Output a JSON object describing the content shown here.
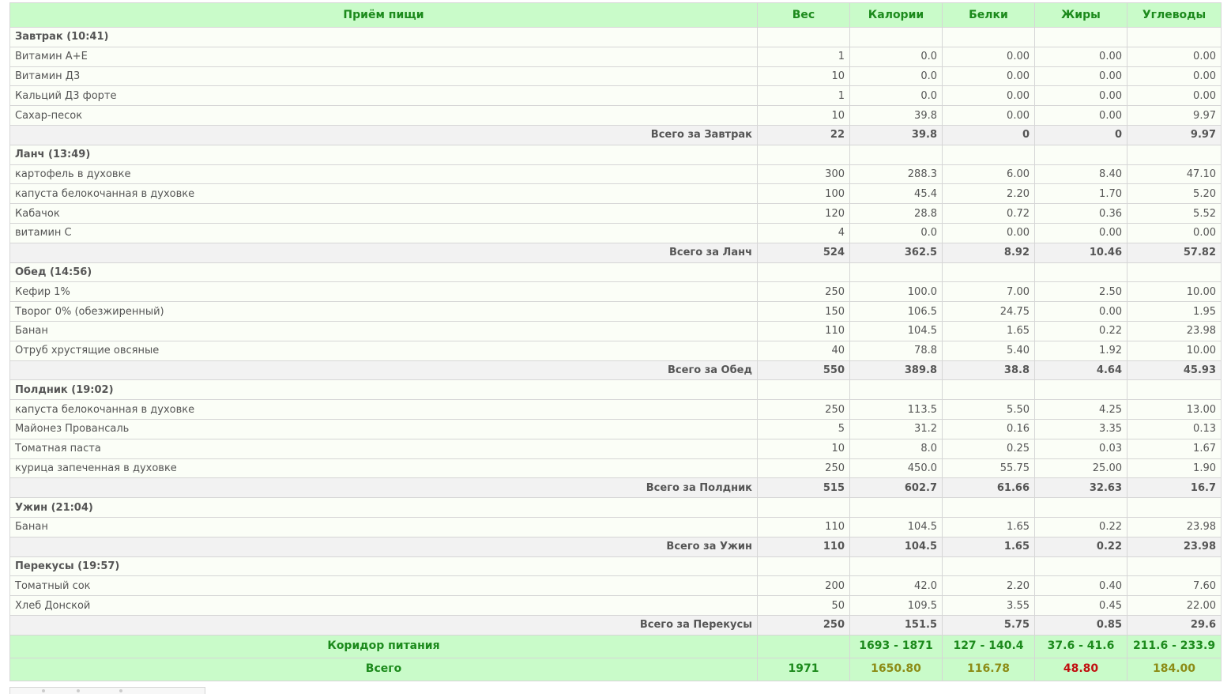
{
  "table": {
    "headers": [
      "Приём пищи",
      "Вес",
      "Калории",
      "Белки",
      "Жиры",
      "Углеводы"
    ],
    "meals": [
      {
        "title": "Завтрак (10:41)",
        "items": [
          [
            "Витамин А+Е",
            "1",
            "0.0",
            "0.00",
            "0.00",
            "0.00"
          ],
          [
            "Витамин Д3",
            "10",
            "0.0",
            "0.00",
            "0.00",
            "0.00"
          ],
          [
            "Кальций Д3 форте",
            "1",
            "0.0",
            "0.00",
            "0.00",
            "0.00"
          ],
          [
            "Сахар-песок",
            "10",
            "39.8",
            "0.00",
            "0.00",
            "9.97"
          ]
        ],
        "total": [
          "Всего за Завтрак",
          "22",
          "39.8",
          "0",
          "0",
          "9.97"
        ]
      },
      {
        "title": "Ланч (13:49)",
        "items": [
          [
            "картофель в духовке",
            "300",
            "288.3",
            "6.00",
            "8.40",
            "47.10"
          ],
          [
            "капуста белокочанная в духовке",
            "100",
            "45.4",
            "2.20",
            "1.70",
            "5.20"
          ],
          [
            "Кабачок",
            "120",
            "28.8",
            "0.72",
            "0.36",
            "5.52"
          ],
          [
            "витамин С",
            "4",
            "0.0",
            "0.00",
            "0.00",
            "0.00"
          ]
        ],
        "total": [
          "Всего за Ланч",
          "524",
          "362.5",
          "8.92",
          "10.46",
          "57.82"
        ]
      },
      {
        "title": "Обед (14:56)",
        "items": [
          [
            "Кефир 1%",
            "250",
            "100.0",
            "7.00",
            "2.50",
            "10.00"
          ],
          [
            "Творог 0% (обезжиренный)",
            "150",
            "106.5",
            "24.75",
            "0.00",
            "1.95"
          ],
          [
            "Банан",
            "110",
            "104.5",
            "1.65",
            "0.22",
            "23.98"
          ],
          [
            "Отруб хрустящие овсяные",
            "40",
            "78.8",
            "5.40",
            "1.92",
            "10.00"
          ]
        ],
        "total": [
          "Всего за Обед",
          "550",
          "389.8",
          "38.8",
          "4.64",
          "45.93"
        ]
      },
      {
        "title": "Полдник (19:02)",
        "items": [
          [
            "капуста белокочанная в духовке",
            "250",
            "113.5",
            "5.50",
            "4.25",
            "13.00"
          ],
          [
            "Майонез Провансаль",
            "5",
            "31.2",
            "0.16",
            "3.35",
            "0.13"
          ],
          [
            "Томатная паста",
            "10",
            "8.0",
            "0.25",
            "0.03",
            "1.67"
          ],
          [
            "курица запеченная в духовке",
            "250",
            "450.0",
            "55.75",
            "25.00",
            "1.90"
          ]
        ],
        "total": [
          "Всего за Полдник",
          "515",
          "602.7",
          "61.66",
          "32.63",
          "16.7"
        ]
      },
      {
        "title": "Ужин (21:04)",
        "items": [
          [
            "Банан",
            "110",
            "104.5",
            "1.65",
            "0.22",
            "23.98"
          ]
        ],
        "total": [
          "Всего за Ужин",
          "110",
          "104.5",
          "1.65",
          "0.22",
          "23.98"
        ]
      },
      {
        "title": "Перекусы (19:57)",
        "items": [
          [
            "Томатный сок",
            "200",
            "42.0",
            "2.20",
            "0.40",
            "7.60"
          ],
          [
            "Хлеб Донской",
            "50",
            "109.5",
            "3.55",
            "0.45",
            "22.00"
          ]
        ],
        "total": [
          "Всего за Перекусы",
          "250",
          "151.5",
          "5.75",
          "0.85",
          "29.6"
        ]
      }
    ],
    "corridor": {
      "label": "Коридор питания",
      "values": [
        "",
        "1693 - 1871",
        "127 - 140.4",
        "37.6 - 41.6",
        "211.6 - 233.9"
      ]
    },
    "grand_total": {
      "label": "Всего",
      "values": [
        "1971",
        "1650.80",
        "116.78",
        "48.80",
        "184.00"
      ],
      "value_colors": [
        "#1c8a1c",
        "#8c8c16",
        "#8c8c16",
        "#c11010",
        "#8c8c16"
      ]
    }
  },
  "colors": {
    "header_bg": "#c9fbc9",
    "header_text": "#1c8a1c",
    "total_row_bg": "#f2f2f2",
    "over_limit": "#c11010",
    "in_range": "#8c8c16"
  }
}
